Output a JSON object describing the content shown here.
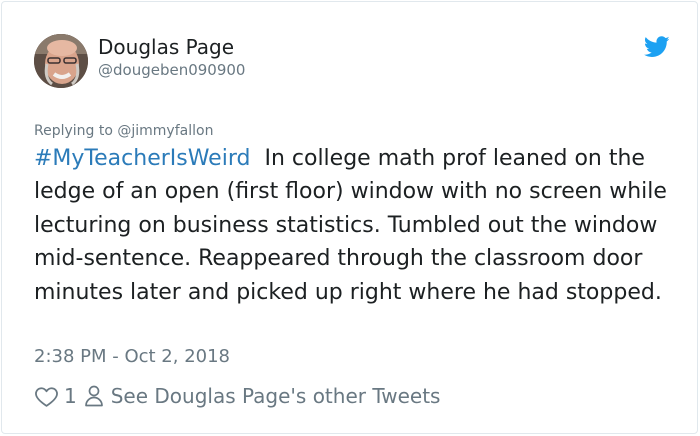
{
  "tweet": {
    "author_name": "Douglas Page",
    "author_handle": "@dougeben090900",
    "replying_to": "Replying to @jimmyfallon",
    "hashtag": "#MyTeacherIsWeird",
    "body": "In college math prof leaned on the ledge of an open (first floor) window with no screen while lecturing on business statistics. Tumbled out the window mid-sentence. Reappeared through the classroom door minutes later and picked up right where he had stopped.",
    "timestamp": "2:38 PM - Oct 2, 2018",
    "like_count": "1",
    "see_more": "See Douglas Page's other Tweets"
  },
  "colors": {
    "twitter_blue": "#1da1f2",
    "hashtag": "#2b7bb9",
    "text": "#1c2022",
    "muted": "#697882",
    "border": "#e1e8ed"
  },
  "icons": {
    "brand": "twitter-bird-icon",
    "like": "heart-icon",
    "profile": "person-icon"
  }
}
